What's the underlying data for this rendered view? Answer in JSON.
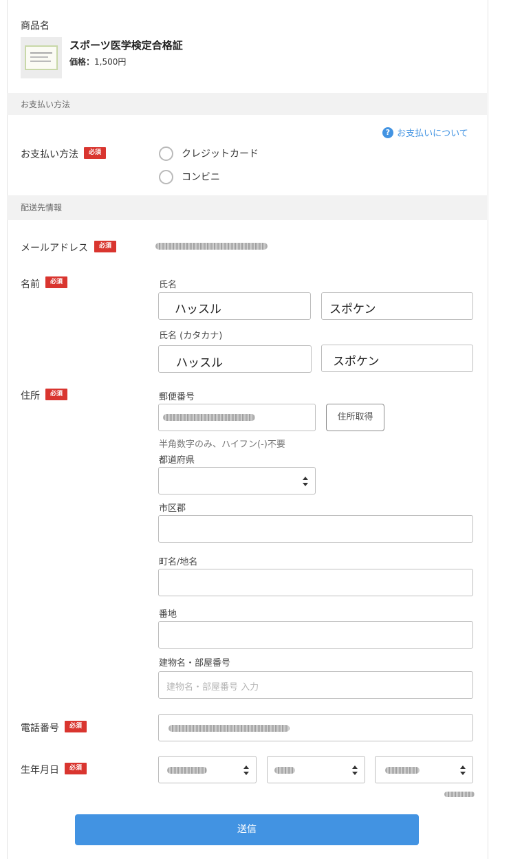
{
  "product": {
    "section_label": "商品名",
    "name": "スポーツ医学検定合格証",
    "price_label": "価格：",
    "price": "1,500円"
  },
  "payment": {
    "section_title": "お支払い方法",
    "help_link": "お支払いについて",
    "field_label": "お支払い方法",
    "required": "必須",
    "options": [
      "クレジットカード",
      "コンビニ"
    ]
  },
  "shipping": {
    "section_title": "配送先情報",
    "email_label": "メールアドレス",
    "name_label": "名前",
    "name_sub_label": "氏名",
    "last_name": "ハッスル",
    "first_name": "スポケン",
    "kana_sub_label": "氏名 (カタカナ)",
    "last_name_kana": "ハッスル",
    "first_name_kana": "スポケン",
    "address_label": "住所",
    "postal_label": "郵便番号",
    "postal_button": "住所取得",
    "postal_hint": "半角数字のみ、ハイフン(-)不要",
    "prefecture_label": "都道府県",
    "city_label": "市区郡",
    "town_label": "町名/地名",
    "street_label": "番地",
    "building_label": "建物名・部屋番号",
    "building_placeholder": "建物名・部屋番号 入力",
    "phone_label": "電話番号",
    "birth_label": "生年月日"
  },
  "submit_label": "送信",
  "colors": {
    "accent": "#4293e2",
    "required_badge": "#d9352f",
    "section_bg": "#f2f2f2"
  }
}
